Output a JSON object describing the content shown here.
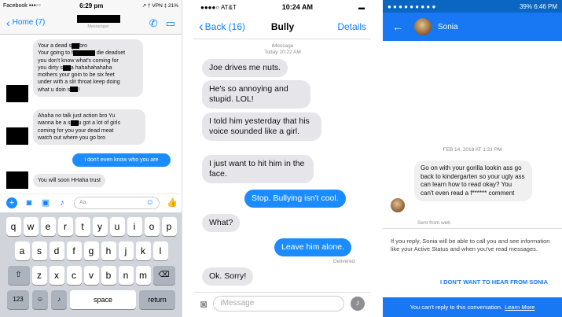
{
  "panel1": {
    "status": {
      "carrier": "Facebook",
      "time": "6:29 pm",
      "right": "↗ † VPN ‡ 21%"
    },
    "nav": {
      "back_label": "Home (7)",
      "subtitle": "Messenger"
    },
    "messages": [
      {
        "lines": [
          "Your a dead s██bro",
          "Your going to f█████ die deadset",
          "you don't know what's coming for",
          "you dirty s██a hahahahahaha",
          "mothers your goin to be six feet",
          "under with a slit throat keep doing",
          "what u doin s██!"
        ]
      },
      {
        "lines": [
          "Ahaha no talk just action bro Yu",
          "wanna be a s██u got a lot of girls",
          "coming for you your dead meat",
          "watch out where you go bro"
        ]
      },
      {
        "text": "i don't even know who you are"
      },
      {
        "text": "You will soon HHaha trust"
      }
    ],
    "composer": {
      "placeholder": "Aa"
    },
    "keyboard": {
      "row1": [
        "q",
        "w",
        "e",
        "r",
        "t",
        "y",
        "u",
        "i",
        "o",
        "p"
      ],
      "row2": [
        "a",
        "s",
        "d",
        "f",
        "g",
        "h",
        "j",
        "k",
        "l"
      ],
      "row3": [
        "z",
        "x",
        "c",
        "v",
        "b",
        "n",
        "m"
      ],
      "num_label": "123",
      "space_label": "space",
      "return_label": "return"
    }
  },
  "panel2": {
    "status": {
      "carrier": "●●●●○ AT&T",
      "time": "10:24 AM"
    },
    "nav": {
      "back_label": "Back (16)",
      "title": "Bully",
      "details_label": "Details"
    },
    "timestamp": {
      "service": "iMessage",
      "when": "Today 10:22 AM"
    },
    "messages": [
      {
        "text": "Joe drives me nuts."
      },
      {
        "text": "He's so annoying and stupid. LOL!"
      },
      {
        "text": "I told him yesterday that his voice sounded like a girl."
      },
      {
        "text": "I just want to hit him in the face."
      },
      {
        "text": "Stop. Bullying isn't cool."
      },
      {
        "text": "What?"
      },
      {
        "text": "Leave him alone."
      },
      {
        "text": "Ok. Sorry!"
      }
    ],
    "delivered_label": "Delivered",
    "composer": {
      "placeholder": "iMessage"
    }
  },
  "panel3": {
    "status": {
      "right": "39% 6:46 PM"
    },
    "nav": {
      "contact_name": "Sonia"
    },
    "timestamp": "FEB 14, 2018 AT 1:31 PM",
    "message": "Go on with your gorilla lookin ass  go  back to kindergarten so your ugly ass can learn how to read okay? You can't even read a f****** comment",
    "sent_from": "Sent from web",
    "info": "If you reply, Sonia will be able to call you and see information like your Active Status and when you've read messages.",
    "dont_want_label": "I DON'T WANT TO HEAR FROM SONIA",
    "cant_reply": "You can't reply to this conversation.",
    "learn_more": "Learn More"
  }
}
